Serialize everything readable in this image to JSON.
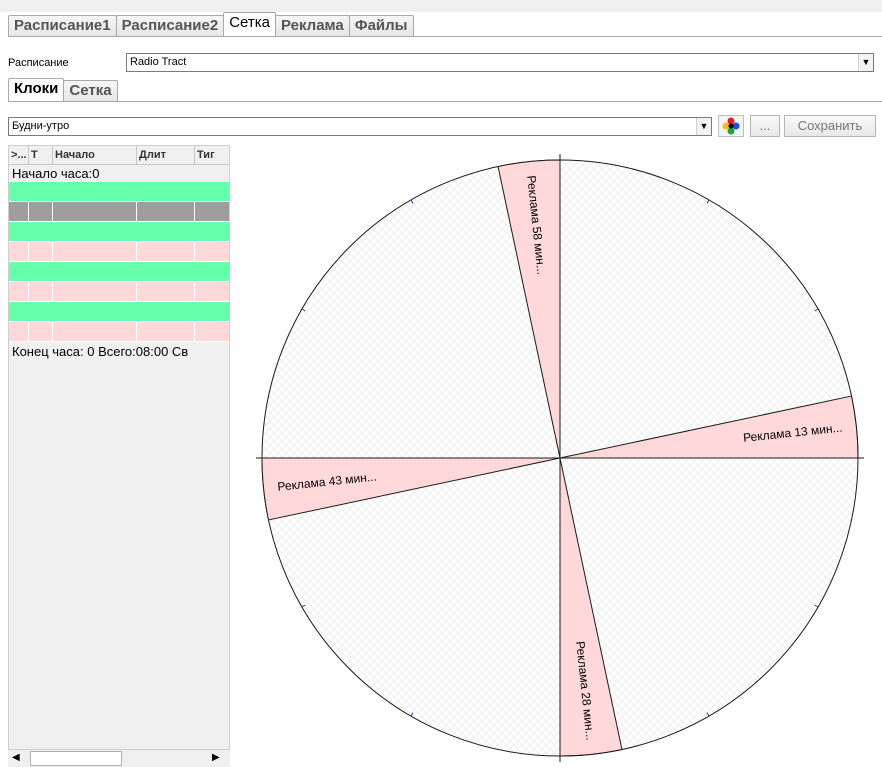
{
  "tabs": [
    "Расписание1",
    "Расписание2",
    "Сетка",
    "Реклама",
    "Файлы"
  ],
  "active_tab": "Сетка",
  "schedule": {
    "label": "Расписание",
    "value": "Radio Tract"
  },
  "subtabs": [
    "Клоки",
    "Сетка"
  ],
  "clock": {
    "value": "Будни-утро",
    "more_label": "...",
    "save_label": "Сохранить"
  },
  "list": {
    "columns": [
      ">...",
      "T",
      "Начало",
      "Длит",
      "Тиг"
    ],
    "header_row": "Начало часа:0",
    "footer_row": "Конец часа: 0 Всего:08:00 Св",
    "rows": [
      "block",
      "separator",
      "block",
      "ad",
      "block",
      "ad",
      "block",
      "ad"
    ]
  },
  "colors": {
    "block": "#66ffaa",
    "separator": "#9e9e9e",
    "ad": "#ffd9d9",
    "line": "#1a1a1a",
    "tick": "#2233aa"
  },
  "clock_chart": {
    "segments": [
      {
        "label": "Реклама 58 мин...",
        "start_min": 58,
        "end_min": 60
      },
      {
        "label": "Реклама 13 мин...",
        "start_min": 13,
        "end_min": 15
      },
      {
        "label": "Реклама 28 мин...",
        "start_min": 28,
        "end_min": 30
      },
      {
        "label": "Реклама 43 мин...",
        "start_min": 43,
        "end_min": 45
      }
    ]
  }
}
